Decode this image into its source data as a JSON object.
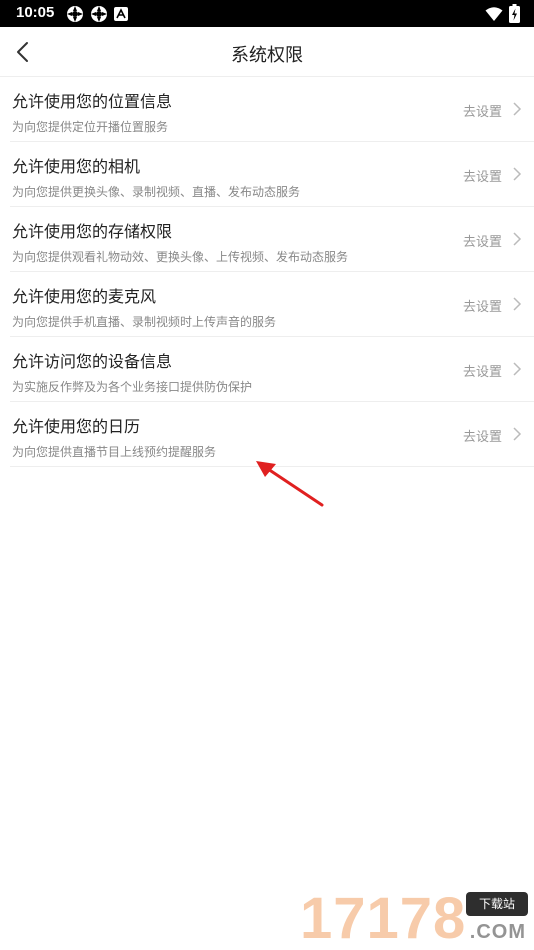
{
  "status_bar": {
    "time": "10:05",
    "left_icons": [
      "notification-icon",
      "notification-icon",
      "app-icon"
    ],
    "right_icons": [
      "wifi-icon",
      "battery-icon"
    ]
  },
  "nav": {
    "title": "系统权限",
    "back_icon": "chevron-left-icon"
  },
  "permissions": [
    {
      "title": "允许使用您的位置信息",
      "desc": "为向您提供定位开播位置服务",
      "action": "去设置"
    },
    {
      "title": "允许使用您的相机",
      "desc": "为向您提供更换头像、录制视频、直播、发布动态服务",
      "action": "去设置"
    },
    {
      "title": "允许使用您的存储权限",
      "desc": "为向您提供观看礼物动效、更换头像、上传视频、发布动态服务",
      "action": "去设置"
    },
    {
      "title": "允许使用您的麦克风",
      "desc": "为向您提供手机直播、录制视频时上传声音的服务",
      "action": "去设置"
    },
    {
      "title": "允许访问您的设备信息",
      "desc": "为实施反作弊及为各个业务接口提供防伪保护",
      "action": "去设置"
    },
    {
      "title": "允许使用您的日历",
      "desc": "为向您提供直播节目上线预约提醒服务",
      "action": "去设置"
    }
  ],
  "watermark": {
    "digits": "17178",
    "tag": "下载站",
    "suffix": ".COM"
  },
  "colors": {
    "arrow": "#e02020",
    "divider": "#eeeeee",
    "desc_text": "#888888"
  }
}
